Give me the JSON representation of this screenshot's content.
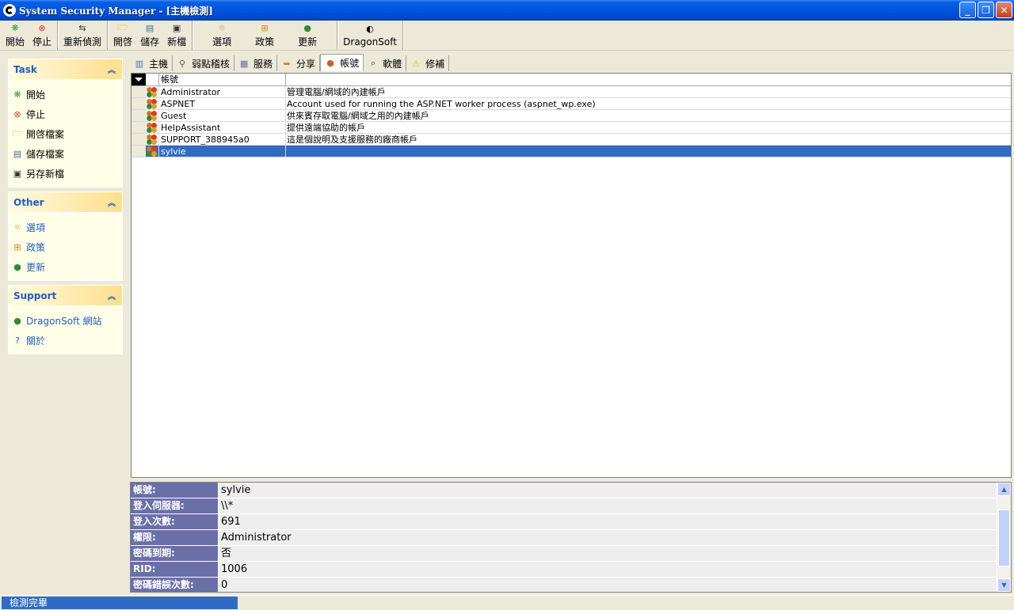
{
  "window": {
    "title": "System Security Manager - [主機檢測]"
  },
  "toolbar": {
    "groups": [
      [
        {
          "label": "開始",
          "icon": "start-icon",
          "color": "#2E9E3A"
        },
        {
          "label": "停止",
          "icon": "stop-icon",
          "color": "#D04020"
        }
      ],
      [
        {
          "label": "重新偵測",
          "icon": "redetect-icon",
          "color": "#333333"
        }
      ],
      [
        {
          "label": "開啓",
          "icon": "open-folder-icon",
          "color": "#E8B020"
        },
        {
          "label": "儲存",
          "icon": "save-icon",
          "color": "#4A6A9A"
        },
        {
          "label": "新檔",
          "icon": "new-file-icon",
          "color": "#333333"
        }
      ],
      [
        {
          "label": "選項",
          "icon": "options-icon",
          "color": "#C8A040"
        },
        {
          "label": "政策",
          "icon": "policy-icon",
          "color": "#D08020"
        },
        {
          "label": "更新",
          "icon": "update-globe-icon",
          "color": "#2E8A3A"
        }
      ],
      [
        {
          "label": "DragonSoft",
          "icon": "dragonsoft-logo-icon",
          "color": "#000000"
        }
      ]
    ]
  },
  "sidebar": {
    "task": {
      "title": "Task",
      "items": [
        {
          "label": "開始",
          "icon": "start-icon"
        },
        {
          "label": "停止",
          "icon": "stop-icon"
        },
        {
          "label": "開啓檔案",
          "icon": "open-folder-icon"
        },
        {
          "label": "儲存檔案",
          "icon": "save-icon"
        },
        {
          "label": "另存新檔",
          "icon": "save-as-icon"
        }
      ]
    },
    "other": {
      "title": "Other",
      "items": [
        {
          "label": "選項",
          "icon": "options-icon"
        },
        {
          "label": "政策",
          "icon": "policy-icon"
        },
        {
          "label": "更新",
          "icon": "update-globe-icon"
        }
      ]
    },
    "support": {
      "title": "Support",
      "items": [
        {
          "label": "DragonSoft 網站",
          "icon": "globe-icon"
        },
        {
          "label": "關於",
          "icon": "help-icon"
        }
      ]
    }
  },
  "tabs": [
    {
      "label": "主機",
      "icon": "host-icon",
      "active": false
    },
    {
      "label": "弱點稽核",
      "icon": "audit-magnifier-icon",
      "active": false
    },
    {
      "label": "服務",
      "icon": "service-icon",
      "active": false
    },
    {
      "label": "分享",
      "icon": "share-icon",
      "active": false
    },
    {
      "label": "帳號",
      "icon": "accounts-icon",
      "active": true
    },
    {
      "label": "軟體",
      "icon": "software-icon",
      "active": false
    },
    {
      "label": "修補",
      "icon": "warning-icon",
      "active": false
    }
  ],
  "grid": {
    "column_header": "帳號",
    "rows": [
      {
        "name": "Administrator",
        "desc": "管理電腦/網域的內建帳戶",
        "selected": false
      },
      {
        "name": "ASPNET",
        "desc": "Account used for running the ASP.NET worker process (aspnet_wp.exe)",
        "selected": false
      },
      {
        "name": "Guest",
        "desc": "供來賓存取電腦/網域之用的內建帳戶",
        "selected": false
      },
      {
        "name": "HelpAssistant",
        "desc": "提供遠端協助的帳戶",
        "selected": false
      },
      {
        "name": "SUPPORT_388945a0",
        "desc": "這是個說明及支援服務的廠商帳戶",
        "selected": false
      },
      {
        "name": "sylvie",
        "desc": "",
        "selected": true
      }
    ]
  },
  "detail": {
    "rows": [
      {
        "label": "帳號:",
        "value": "sylvie"
      },
      {
        "label": "登入伺服器:",
        "value": "\\\\*"
      },
      {
        "label": "登入次數:",
        "value": "691"
      },
      {
        "label": "權限:",
        "value": "Administrator"
      },
      {
        "label": "密碼到期:",
        "value": "否"
      },
      {
        "label": "RID:",
        "value": "1006"
      },
      {
        "label": "密碼錯誤次數:",
        "value": "0"
      }
    ]
  },
  "status": {
    "text": "檢測完畢"
  }
}
